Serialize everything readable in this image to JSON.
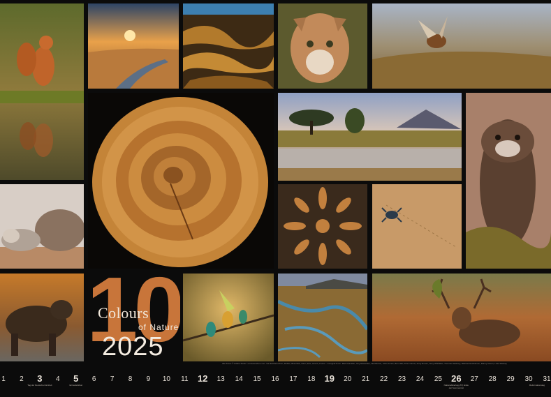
{
  "calendar": {
    "month_number": "10",
    "title_line1": "Colours",
    "title_line2": "of Nature",
    "year": "2025",
    "credits": "Alle Fotos © Adobe Stock / mit Ausnahme von: rote Eichhörnchen, Robbe, Braunbär, Otter, Eule, Hirsch, Fuchs – Fotograf:innen: Mark Hamblin, Guy Edwardes, Neil Burton, Chris Jones, Ben Hall, Peter Cairns, Andy Rouse, Terry Whittaker, Thomas Hackney, Michael Hutchinson, Danny Green, Luke Massey",
    "days": [
      {
        "n": "1",
        "big": false,
        "note": ""
      },
      {
        "n": "2",
        "big": false,
        "note": ""
      },
      {
        "n": "3",
        "big": true,
        "note": "Tag der Deutschen Einheit"
      },
      {
        "n": "4",
        "big": false,
        "note": ""
      },
      {
        "n": "5",
        "big": true,
        "note": "Erntedankfest"
      },
      {
        "n": "6",
        "big": false,
        "note": ""
      },
      {
        "n": "7",
        "big": false,
        "note": ""
      },
      {
        "n": "8",
        "big": false,
        "note": ""
      },
      {
        "n": "9",
        "big": false,
        "note": ""
      },
      {
        "n": "10",
        "big": false,
        "note": ""
      },
      {
        "n": "11",
        "big": false,
        "note": ""
      },
      {
        "n": "12",
        "big": true,
        "note": ""
      },
      {
        "n": "13",
        "big": false,
        "note": ""
      },
      {
        "n": "14",
        "big": false,
        "note": ""
      },
      {
        "n": "15",
        "big": false,
        "note": ""
      },
      {
        "n": "16",
        "big": false,
        "note": ""
      },
      {
        "n": "17",
        "big": false,
        "note": ""
      },
      {
        "n": "18",
        "big": false,
        "note": ""
      },
      {
        "n": "19",
        "big": true,
        "note": ""
      },
      {
        "n": "20",
        "big": false,
        "note": ""
      },
      {
        "n": "21",
        "big": false,
        "note": ""
      },
      {
        "n": "22",
        "big": false,
        "note": ""
      },
      {
        "n": "23",
        "big": false,
        "note": ""
      },
      {
        "n": "24",
        "big": false,
        "note": ""
      },
      {
        "n": "25",
        "big": false,
        "note": ""
      },
      {
        "n": "26",
        "big": true,
        "note": "Nationalfeiertag (AT) Ende der Sommerzeit"
      },
      {
        "n": "27",
        "big": false,
        "note": ""
      },
      {
        "n": "28",
        "big": false,
        "note": ""
      },
      {
        "n": "29",
        "big": false,
        "note": ""
      },
      {
        "n": "30",
        "big": false,
        "note": ""
      },
      {
        "n": "31",
        "big": false,
        "note": "Reformationstag"
      }
    ]
  },
  "colors": {
    "accent": "#c8753a",
    "background": "#0b0b0b",
    "text": "#f1e7da"
  }
}
